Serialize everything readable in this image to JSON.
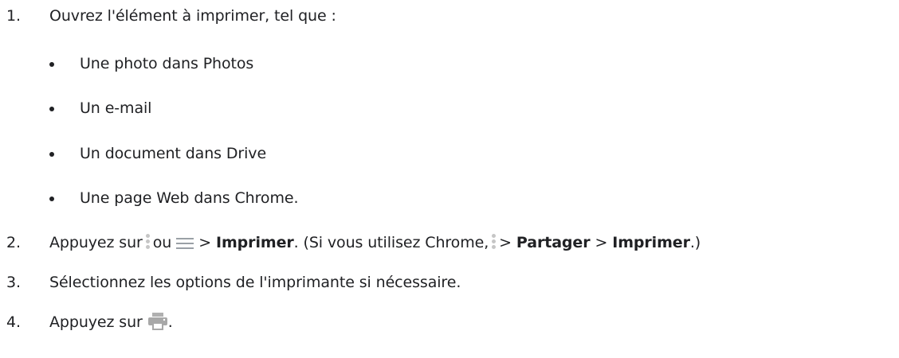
{
  "steps": [
    {
      "number": "1.",
      "text": "Ouvrez l'élément à imprimer, tel que :",
      "subitems": [
        "Une photo dans Photos",
        "Un e-mail",
        "Un document dans Drive",
        "Une page Web dans Chrome."
      ]
    },
    {
      "number": "2.",
      "parts": {
        "prefix": "Appuyez sur",
        "or": "ou",
        "sep1": ">",
        "bold1": "Imprimer",
        "paren_open": ". (Si vous utilisez Chrome,",
        "sep2": ">",
        "bold2": "Partager",
        "sep3": ">",
        "bold3": "Imprimer",
        "paren_close": ".)"
      },
      "icons": [
        "more-vert-icon",
        "menu-icon",
        "more-vert-icon"
      ]
    },
    {
      "number": "3.",
      "text": "Sélectionnez les options de l'imprimante si nécessaire."
    },
    {
      "number": "4.",
      "prefix": "Appuyez sur",
      "suffix": ".",
      "icons": [
        "print-icon"
      ]
    }
  ],
  "colors": {
    "text": "#202124",
    "icon_light": "#c6c6c6",
    "icon_menu": "#9aa0a6",
    "icon_print": "#a8a8a8"
  }
}
